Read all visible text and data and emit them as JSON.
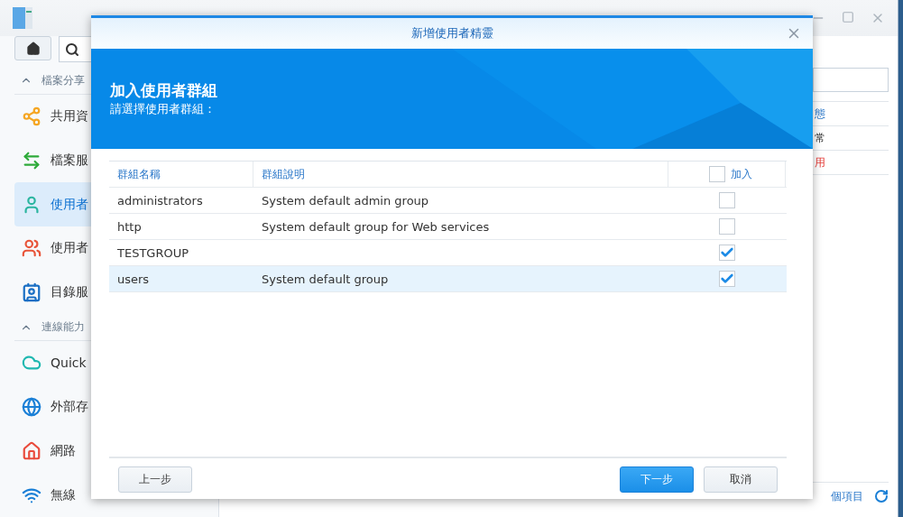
{
  "sidebar": {
    "sections": [
      {
        "title": "檔案分享",
        "expanded": true,
        "items": [
          {
            "label": "共用資",
            "kind": "share",
            "selected": false
          },
          {
            "label": "檔案服",
            "kind": "transfer",
            "selected": false
          },
          {
            "label": "使用者",
            "kind": "user",
            "selected": true
          },
          {
            "label": "使用者",
            "kind": "group",
            "selected": false
          },
          {
            "label": "目錄服",
            "kind": "directory",
            "selected": false
          }
        ]
      },
      {
        "title": "連線能力",
        "expanded": true,
        "items": [
          {
            "label": "Quick",
            "kind": "cloud",
            "selected": false
          },
          {
            "label": "外部存",
            "kind": "globe",
            "selected": false
          },
          {
            "label": "網路",
            "kind": "network",
            "selected": false
          },
          {
            "label": "無線",
            "kind": "wifi",
            "selected": false
          }
        ]
      }
    ]
  },
  "content": {
    "column_header": "態",
    "rows": [
      {
        "text": "常",
        "kind": "normal"
      },
      {
        "text": "用",
        "kind": "alert"
      }
    ],
    "footer": "個項目"
  },
  "dialog": {
    "title": "新增使用者精靈",
    "heading": "加入使用者群組",
    "subheading": "請選擇使用者群組：",
    "columns": [
      "群組名稱",
      "群組說明"
    ],
    "join_header": {
      "label": "加入",
      "checked": false
    },
    "rows": [
      {
        "name": "administrators",
        "description": "System default admin group",
        "checked": false,
        "selected": false
      },
      {
        "name": "http",
        "description": "System default group for Web services",
        "checked": false,
        "selected": false
      },
      {
        "name": "TESTGROUP",
        "checked": true,
        "selected": false
      },
      {
        "name": "users",
        "description": "System default group",
        "checked": true,
        "selected": true
      }
    ],
    "left_buttons": [
      {
        "label": "上一步"
      }
    ],
    "right_buttons": [
      {
        "label": "下一步",
        "kind": "primary"
      },
      {
        "label": "取消",
        "kind": "default"
      }
    ]
  }
}
